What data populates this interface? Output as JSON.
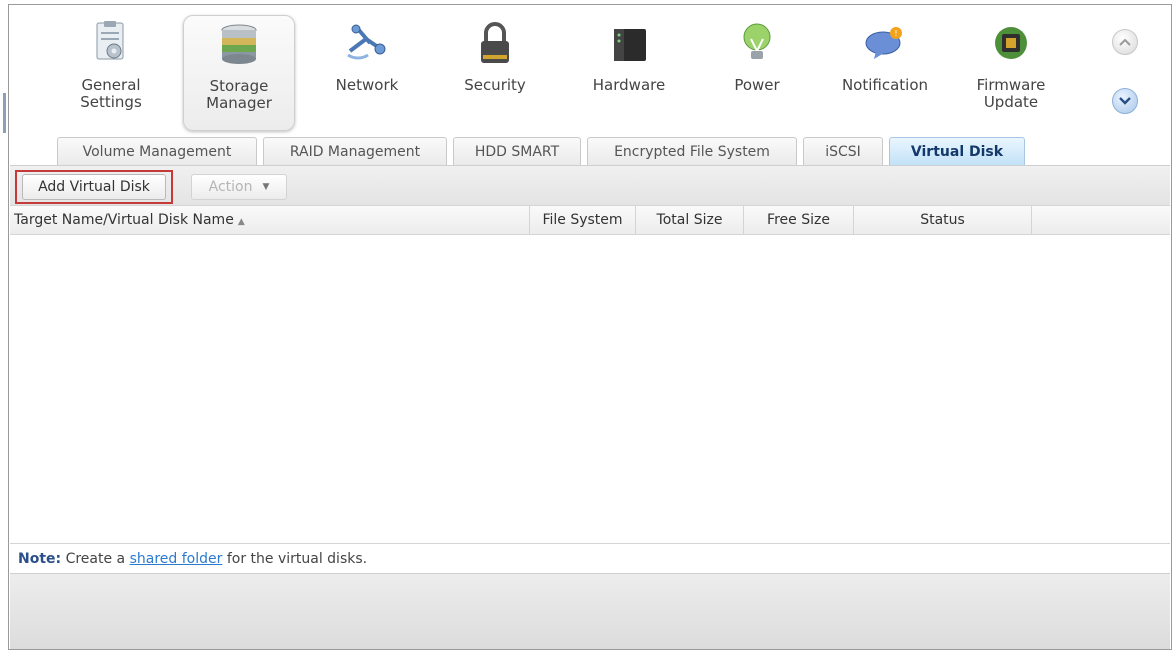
{
  "apps": [
    {
      "label": "General\nSettings",
      "icon": "general-settings-icon"
    },
    {
      "label": "Storage\nManager",
      "icon": "storage-manager-icon",
      "active": true
    },
    {
      "label": "Network",
      "icon": "network-icon"
    },
    {
      "label": "Security",
      "icon": "lock-icon"
    },
    {
      "label": "Hardware",
      "icon": "hardware-icon"
    },
    {
      "label": "Power",
      "icon": "power-bulb-icon"
    },
    {
      "label": "Notification",
      "icon": "notification-icon"
    },
    {
      "label": "Firmware\nUpdate",
      "icon": "firmware-update-icon"
    }
  ],
  "tabs": [
    {
      "label": "Volume Management"
    },
    {
      "label": "RAID Management"
    },
    {
      "label": "HDD SMART"
    },
    {
      "label": "Encrypted File System"
    },
    {
      "label": "iSCSI"
    },
    {
      "label": "Virtual Disk",
      "active": true
    }
  ],
  "toolbar": {
    "add_label": "Add Virtual Disk",
    "action_label": "Action"
  },
  "grid": {
    "columns": [
      "Target Name/Virtual Disk Name",
      "File System",
      "Total Size",
      "Free Size",
      "Status"
    ],
    "rows": []
  },
  "note": {
    "prefix": "Note:",
    "text_before": " Create a ",
    "link": "shared folder",
    "text_after": " for the virtual disks."
  },
  "colors": {
    "active_tab": "#bfe0f6",
    "highlight_border": "#c43a3a",
    "link": "#2a7bd0"
  }
}
